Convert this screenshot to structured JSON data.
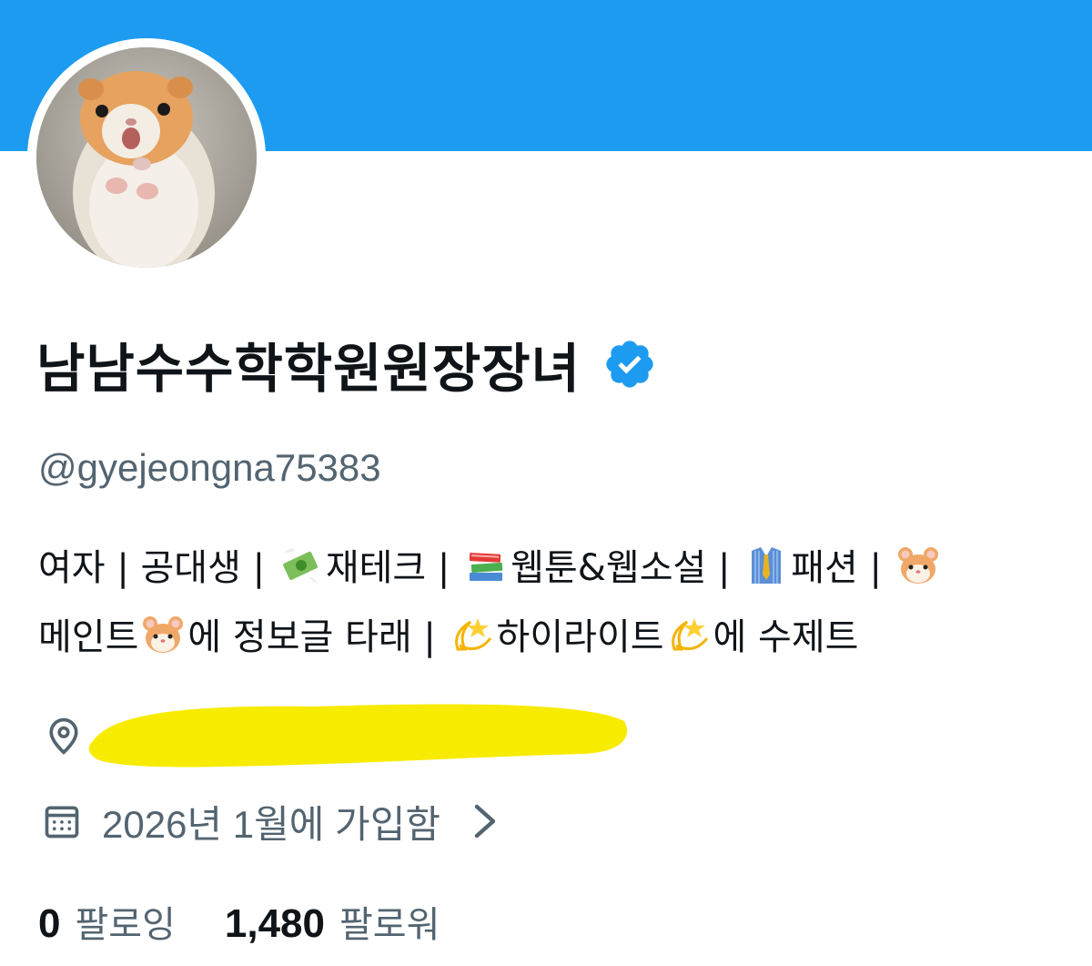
{
  "profile": {
    "display_name": "남남수수학학원원장장녀",
    "handle": "@gyejeongna75383",
    "verified": true,
    "bio": {
      "line1": [
        {
          "type": "text",
          "value": "여자 | 공대생 | "
        },
        {
          "type": "emoji",
          "icon": "money-with-wings-emoji"
        },
        {
          "type": "text",
          "value": "재테크 | "
        },
        {
          "type": "emoji",
          "icon": "books-emoji"
        },
        {
          "type": "text",
          "value": "웹툰&웹소설 | "
        },
        {
          "type": "emoji",
          "icon": "necktie-shirt-emoji"
        },
        {
          "type": "text",
          "value": "패션 | "
        },
        {
          "type": "emoji",
          "icon": "hamster-emoji"
        }
      ],
      "line2": [
        {
          "type": "text",
          "value": "메인트"
        },
        {
          "type": "emoji",
          "icon": "hamster-emoji"
        },
        {
          "type": "text",
          "value": "에 정보글 타래 | "
        },
        {
          "type": "emoji",
          "icon": "dizzy-star-emoji"
        },
        {
          "type": "text",
          "value": "하이라이트"
        },
        {
          "type": "emoji",
          "icon": "dizzy-star-emoji"
        },
        {
          "type": "text",
          "value": "에 수제트"
        }
      ]
    },
    "location": {
      "icon": "location-pin-icon",
      "text": "",
      "redacted": true
    },
    "joined": {
      "icon": "calendar-icon",
      "text": "2026년 1월에 가입함"
    },
    "stats": {
      "following_count": "0",
      "following_label": "팔로잉",
      "followers_count": "1,480",
      "followers_label": "팔로워"
    }
  },
  "colors": {
    "banner": "#1d9bf0",
    "verified_badge": "#1d9bf0",
    "secondary_text": "#536471",
    "primary_text": "#0f1419",
    "redaction_highlight": "#f7eb00"
  }
}
